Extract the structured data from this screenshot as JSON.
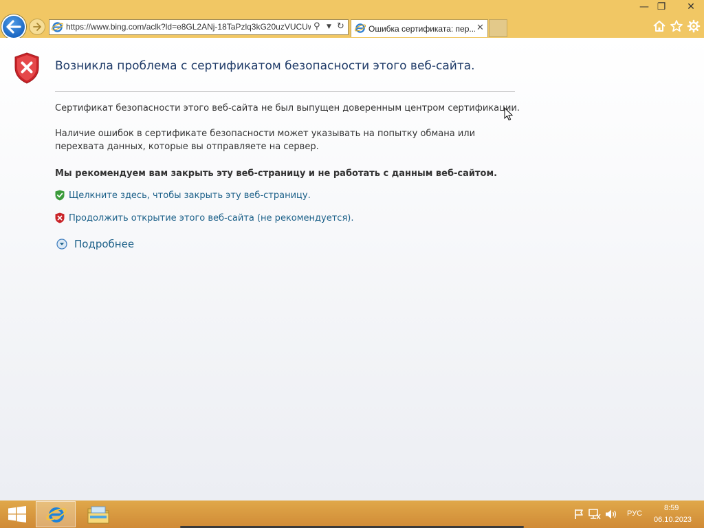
{
  "window": {
    "minimize_glyph": "—",
    "restore_glyph": "❐",
    "close_glyph": "✕"
  },
  "address_bar": {
    "url": "https://www.bing.com/aclk?ld=e8GL2ANj-18TaPzlq3kG20uzVUCUw"
  },
  "tab": {
    "title": "Ошибка сертификата: пер...",
    "close_glyph": "✕"
  },
  "toolbar_icons": [
    "home-icon",
    "favorites-icon",
    "settings-icon"
  ],
  "page": {
    "title": "Возникла проблема с сертификатом безопасности этого веб-сайта.",
    "paragraph_1": "Сертификат безопасности этого веб-сайта не был выпущен доверенным центром сертификации.",
    "paragraph_2": "Наличие ошибок в сертификате безопасности может указывать на попытку обмана или перехвата данных, которые вы отправляете на сервер.",
    "recommendation": "Мы рекомендуем вам закрыть эту веб-страницу и не работать с данным веб-сайтом.",
    "action_close": "Щелкните здесь, чтобы закрыть эту веб-страницу.",
    "action_continue": "Продолжить открытие этого веб-сайта (не рекомендуется).",
    "more_info": "Подробнее"
  },
  "taskbar": {
    "pinned": [
      "internet-explorer",
      "file-explorer"
    ],
    "language": "РУС",
    "time": "8:59",
    "date": "06.10.2023"
  },
  "colors": {
    "chrome": "#f1c764",
    "link": "#1a5f88",
    "title": "#1f3b68",
    "taskbar": "#d9993f"
  }
}
